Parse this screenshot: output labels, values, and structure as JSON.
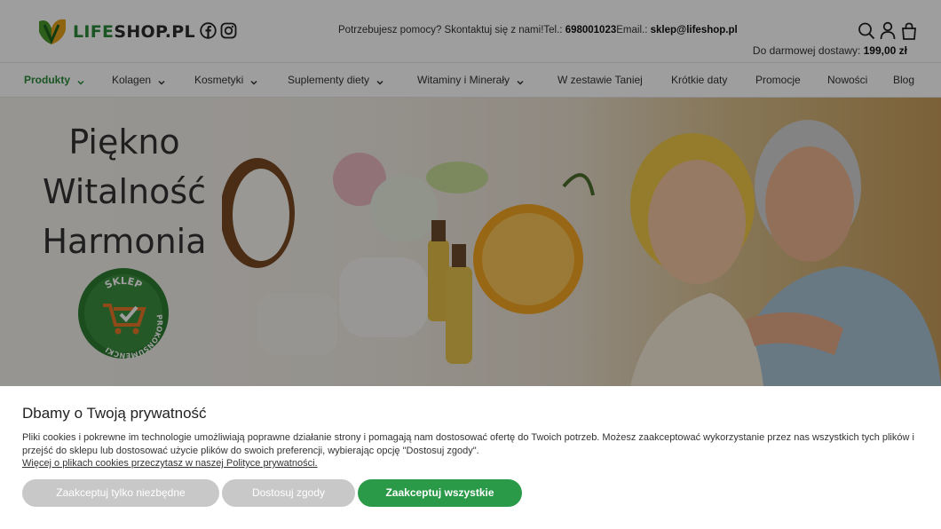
{
  "header": {
    "logo_text_prefix": "LIFE",
    "logo_text_suffix": "SHOP.PL",
    "help_text": "Potrzebujesz pomocy? Skontaktuj się z nami!Tel.: ",
    "phone": "698001023",
    "email_label": "Email.: ",
    "email": "sklep@lifeshop.pl",
    "free_shipping_label": "Do darmowej dostawy: ",
    "free_shipping_amount": "199,00 zł"
  },
  "nav": {
    "items": [
      {
        "label": "Produkty",
        "has_dropdown": true
      },
      {
        "label": "Kolagen",
        "has_dropdown": true
      },
      {
        "label": "Kosmetyki",
        "has_dropdown": true
      },
      {
        "label": "Suplementy diety",
        "has_dropdown": true
      },
      {
        "label": "Witaminy i Minerały",
        "has_dropdown": true
      },
      {
        "label": "W zestawie Taniej",
        "has_dropdown": false
      },
      {
        "label": "Krótkie daty",
        "has_dropdown": false
      },
      {
        "label": "Promocje",
        "has_dropdown": false
      },
      {
        "label": "Nowości",
        "has_dropdown": false
      },
      {
        "label": "Blog",
        "has_dropdown": false
      }
    ]
  },
  "hero": {
    "line1": "Piękno",
    "line2": "Witalność",
    "line3": "Harmonia",
    "badge_top": "SKLEP",
    "badge_bottom": "PROKONSUMENCKI"
  },
  "cookie": {
    "title": "Dbamy o Twoją prywatność",
    "body": "Pliki cookies i pokrewne im technologie umożliwiają poprawne działanie strony i pomagają nam dostosować ofertę do Twoich potrzeb. Możesz zaakceptować wykorzystanie przez nas wszystkich tych plików i przejść do sklepu lub dostosować użycie plików do swoich preferencji, wybierając opcję \"Dostosuj zgody\".",
    "link": "Więcej o plikach cookies przeczytasz w naszej Polityce prywatności.",
    "btn_necessary": "Zaakceptuj tylko niezbędne",
    "btn_customize": "Dostosuj zgody",
    "btn_accept_all": "Zaakceptuj wszystkie"
  },
  "colors": {
    "brand_green": "#2a8a3a",
    "accept_green": "#2a9a48",
    "muted_button": "#c8c8c8"
  },
  "icons": [
    "facebook-icon",
    "instagram-icon",
    "search-icon",
    "user-icon",
    "cart-icon",
    "chevron-down-icon"
  ]
}
